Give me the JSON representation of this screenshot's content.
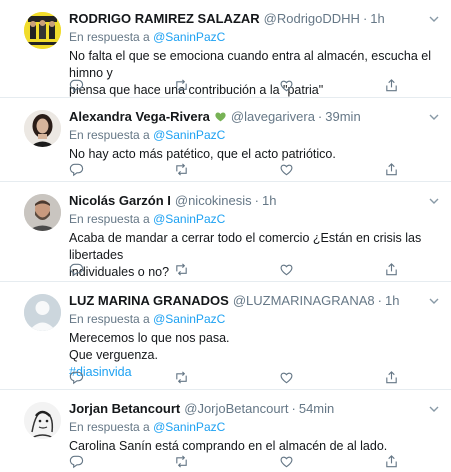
{
  "tweets": [
    {
      "name": "RODRIGO RAMIREZ SALAZAR",
      "handle": "@RodrigoDDHH",
      "separator": "·",
      "time": "1h",
      "reply_prefix": "En respuesta a",
      "reply_to": "@SaninPazC",
      "lines": [
        "No falta el que se emociona cuando entra al almacén, escucha el himno y",
        "piensa que hace una contribución a la \"patria\""
      ],
      "avatar_icon": "book-cover-avatar"
    },
    {
      "name": "Alexandra Vega-Rivera",
      "name_emoji": "green-heart-icon",
      "handle": "@lavegarivera",
      "separator": "·",
      "time": "39min",
      "reply_prefix": "En respuesta a",
      "reply_to": "@SaninPazC",
      "lines": [
        "No hay acto más patético, que el acto patriótico."
      ],
      "avatar_icon": "portrait-avatar"
    },
    {
      "name": "Nicolás Garzón I",
      "handle": "@nicokinesis",
      "separator": "·",
      "time": "1h",
      "reply_prefix": "En respuesta a",
      "reply_to": "@SaninPazC",
      "lines": [
        "Acaba de mandar a cerrar todo el comercio ¿Están en crisis las libertades",
        "individuales o no?"
      ],
      "avatar_icon": "bearded-man-avatar"
    },
    {
      "name": "LUZ MARINA GRANADOS",
      "handle": "@LUZMARINAGRANA8",
      "separator": "·",
      "time": "1h",
      "reply_prefix": "En respuesta a",
      "reply_to": "@SaninPazC",
      "lines": [
        "Merecemos lo que nos pasa.",
        "Que verguenza."
      ],
      "hashtag": "#diasinvida",
      "avatar_icon": "default-profile-avatar"
    },
    {
      "name": "Jorjan Betancourt",
      "handle": "@JorjoBetancourt",
      "separator": "·",
      "time": "54min",
      "reply_prefix": "En respuesta a",
      "reply_to": "@SaninPazC",
      "lines": [
        "Carolina Sanín está comprando en el almacén de al lado."
      ],
      "avatar_icon": "sketch-avatar"
    }
  ],
  "action_icons": [
    "reply-icon",
    "retweet-icon",
    "like-icon",
    "share-icon"
  ],
  "colors": {
    "text": "#14171a",
    "secondary": "#657786",
    "link": "#1da1f2",
    "border": "#e6ecf0",
    "heart": "#77b255"
  }
}
